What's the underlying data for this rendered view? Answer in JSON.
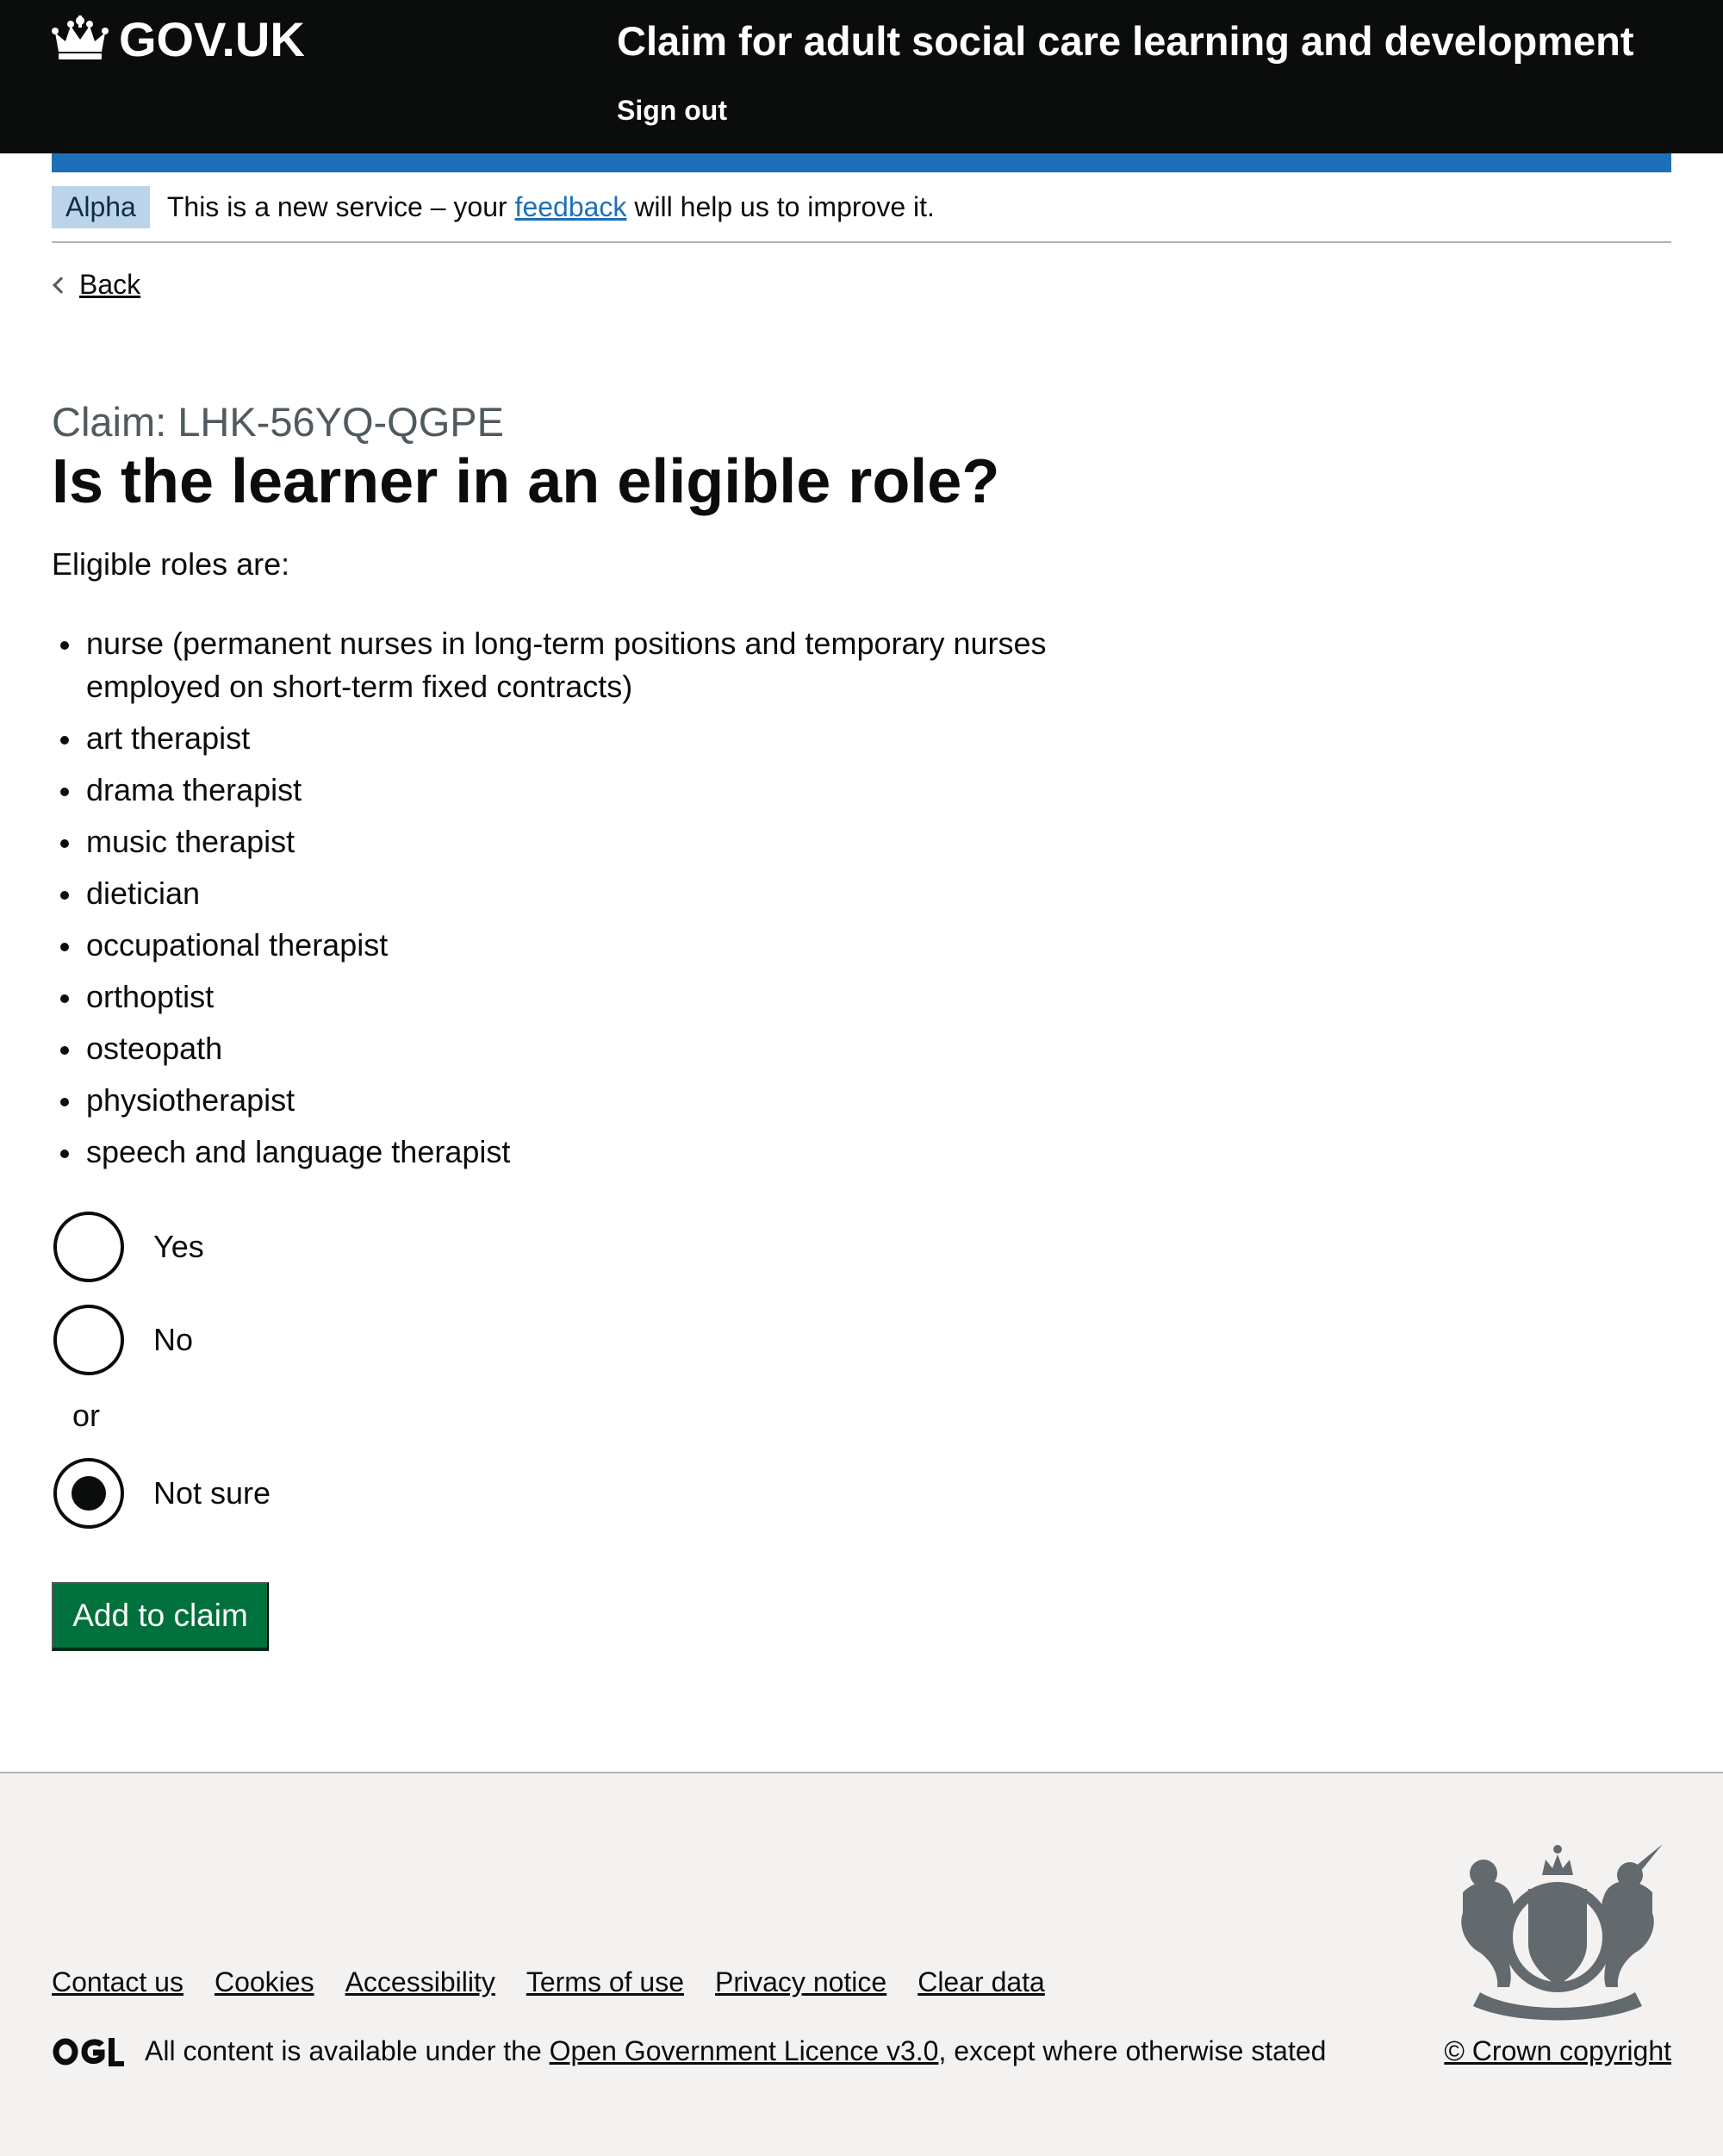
{
  "header": {
    "logo_text": "GOV.UK",
    "service_name": "Claim for adult social care learning and development",
    "sign_out": "Sign out"
  },
  "phase_banner": {
    "tag": "Alpha",
    "text_before": "This is a new service – your ",
    "link": "feedback",
    "text_after": " will help us to improve it."
  },
  "back_link": "Back",
  "caption": "Claim: LHK-56YQ-QGPE",
  "heading": "Is the learner in an eligible role?",
  "intro": "Eligible roles are:",
  "roles": [
    "nurse (permanent nurses in long-term positions and temporary nurses employed on short-term fixed contracts)",
    "art therapist",
    "drama therapist",
    "music therapist",
    "dietician",
    "occupational therapist",
    "orthoptist",
    "osteopath",
    "physiotherapist",
    "speech and language therapist"
  ],
  "options": {
    "yes": "Yes",
    "no": "No",
    "divider": "or",
    "not_sure": "Not sure",
    "selected": "Not sure"
  },
  "submit_button": "Add to claim",
  "footer": {
    "links": [
      "Contact us",
      "Cookies",
      "Accessibility",
      "Terms of use",
      "Privacy notice",
      "Clear data"
    ],
    "licence_before": "All content is available under the ",
    "licence_link": "Open Government Licence v3.0",
    "licence_after": ", except where otherwise stated",
    "copyright": "© Crown copyright"
  },
  "colors": {
    "header_bg": "#0b0c0c",
    "accent_blue": "#1d70b8",
    "button_green": "#00703c",
    "footer_bg": "#f3f2f1",
    "tag_bg": "#bbd4ea"
  }
}
